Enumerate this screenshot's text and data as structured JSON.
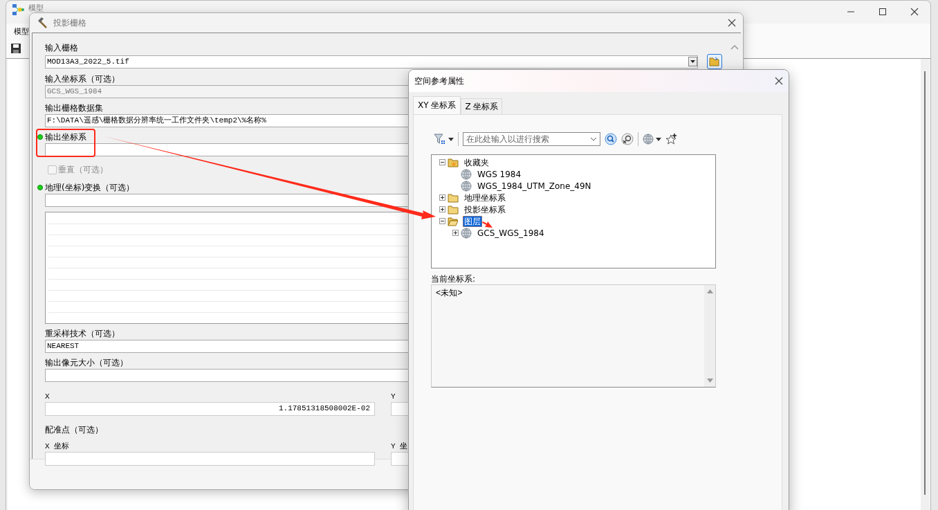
{
  "main_window": {
    "title": "模型",
    "menu": [
      "模型"
    ]
  },
  "tool_dialog": {
    "title": "投影栅格",
    "fields": [
      {
        "kind": "combo",
        "label": "输入栅格",
        "required": false,
        "value": "MOD13A3_2022_5.tif",
        "disabled": false
      },
      {
        "kind": "text",
        "label": "输入坐标系（可选）",
        "required": false,
        "value": "GCS_WGS_1984",
        "disabled": true
      },
      {
        "kind": "text",
        "label": "输出栅格数据集",
        "required": false,
        "value": "F:\\DATA\\遥感\\栅格数据分辨率统一工作文件夹\\temp2\\%名称%",
        "disabled": false
      },
      {
        "kind": "text",
        "label": "输出坐标系",
        "required": true,
        "disabled": false
      },
      {
        "kind": "checkbox",
        "label": "垂直（可选）",
        "checked": false,
        "disabled": true
      },
      {
        "kind": "list",
        "label": "地理(坐标)变换（可选）",
        "required": true,
        "disabled": false
      },
      {
        "kind": "text",
        "label": "重采样技术（可选）",
        "required": false,
        "value": "NEAREST",
        "disabled": false
      },
      {
        "kind": "text",
        "label": "输出像元大小（可选）",
        "required": false,
        "disabled": false
      },
      {
        "kind": "pair",
        "labels": [
          "X",
          "Y"
        ],
        "value": "1.17851318508002E-02"
      },
      {
        "kind": "heading",
        "label": "配准点（可选）"
      },
      {
        "kind": "pair",
        "labels": [
          "X 坐标",
          "Y 坐"
        ]
      }
    ]
  },
  "sr_dialog": {
    "title": "空间参考属性",
    "tabs": [
      {
        "label": "XY 坐标系",
        "selected": true
      },
      {
        "label": "Z 坐标系",
        "selected": false
      }
    ],
    "search": {
      "placeholder": "在此处输入以进行搜索"
    },
    "tree": [
      {
        "label": "收藏夹",
        "kind": "favorites",
        "expanded": true,
        "selected": false,
        "children": [
          {
            "label": "WGS 1984",
            "kind": "crs",
            "selected": false
          },
          {
            "label": "WGS_1984_UTM_Zone_49N",
            "kind": "crs",
            "selected": false
          }
        ]
      },
      {
        "label": "地理坐标系",
        "kind": "folder",
        "expanded": false,
        "selected": false
      },
      {
        "label": "投影坐标系",
        "kind": "folder",
        "expanded": false,
        "selected": false
      },
      {
        "label": "图层",
        "kind": "folder",
        "expanded": true,
        "selected": true,
        "children": [
          {
            "label": "GCS_WGS_1984",
            "kind": "crs",
            "expanded": false,
            "selected": false
          }
        ]
      }
    ],
    "current": {
      "label": "当前坐标系:",
      "value": "<未知>"
    }
  }
}
